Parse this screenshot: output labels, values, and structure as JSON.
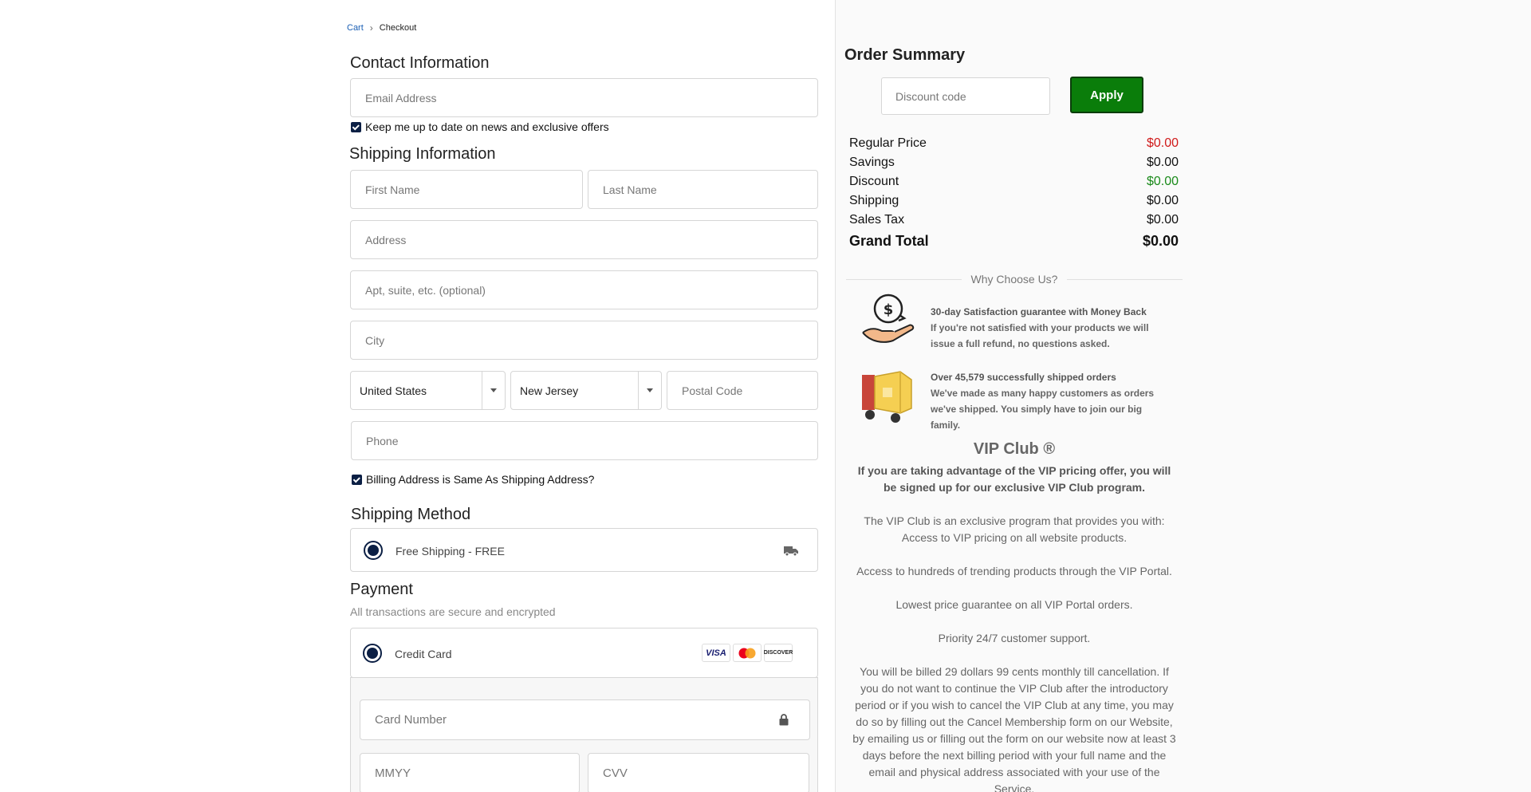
{
  "breadcrumb": {
    "cart": "Cart",
    "current": "Checkout"
  },
  "contact": {
    "title": "Contact Information",
    "email_placeholder": "Email Address",
    "newsletter_label": "Keep me up to date on news and exclusive offers"
  },
  "shipping": {
    "title": "Shipping Information",
    "first_name_placeholder": "First Name",
    "last_name_placeholder": "Last Name",
    "address_placeholder": "Address",
    "apt_placeholder": "Apt, suite, etc. (optional)",
    "city_placeholder": "City",
    "country": "United States",
    "state": "New Jersey",
    "postal_placeholder": "Postal Code",
    "phone_placeholder": "Phone",
    "billing_same_label": "Billing Address is Same As Shipping Address?"
  },
  "shipping_method": {
    "title": "Shipping Method",
    "option": "Free Shipping - FREE"
  },
  "payment": {
    "title": "Payment",
    "subtitle": "All transactions are secure and encrypted",
    "method": "Credit Card",
    "cards": [
      "VISA",
      "mastercard",
      "DISCOVER"
    ],
    "card_number_placeholder": "Card Number",
    "mmyy_placeholder": "MMYY",
    "cvv_placeholder": "CVV"
  },
  "summary": {
    "title": "Order Summary",
    "discount_placeholder": "Discount code",
    "apply_label": "Apply",
    "rows": {
      "regular": {
        "label": "Regular Price",
        "value": "$0.00"
      },
      "savings": {
        "label": "Savings",
        "value": "$0.00"
      },
      "discount": {
        "label": "Discount",
        "value": "$0.00"
      },
      "shipping": {
        "label": "Shipping",
        "value": "$0.00"
      },
      "tax": {
        "label": "Sales Tax",
        "value": "$0.00"
      },
      "grand": {
        "label": "Grand Total",
        "value": "$0.00"
      }
    },
    "colors": {
      "regular_value": "#d01a1a",
      "discount_value": "#1a8a1a",
      "apply_button": "#0a7d0a"
    }
  },
  "why": {
    "title": "Why Choose Us?",
    "features": [
      {
        "icon": "money-back-hand-icon",
        "title": "30-day Satisfaction guarantee with Money Back",
        "text": "If you're not satisfied with your products we will issue a full refund, no questions asked."
      },
      {
        "icon": "delivery-truck-icon",
        "title": "Over 45,579 successfully shipped orders",
        "text": "We've made as many happy customers as orders we've shipped. You simply have to join our big family."
      }
    ]
  },
  "vip": {
    "title": "VIP Club ®",
    "intro": "If you are taking advantage of the VIP pricing offer, you will be signed up for our exclusive VIP Club program.",
    "p1": "The VIP Club is an exclusive program that provides you with: Access to VIP pricing on all website products.",
    "p2": "Access to hundreds of trending products through the VIP Portal.",
    "p3": "Lowest price guarantee on all VIP Portal orders.",
    "p4": "Priority 24/7 customer support.",
    "p5": "You will be billed 29 dollars 99 cents monthly till cancellation. If you do not want to continue the VIP Club after the introductory period or if you wish to cancel the VIP Club at any time, you may do so by filling out the Cancel Membership form on our Website, by emailing us or filling out the form on our website now at least 3 days before the next billing period with your full name and the email and physical address associated with your use of the Service."
  }
}
